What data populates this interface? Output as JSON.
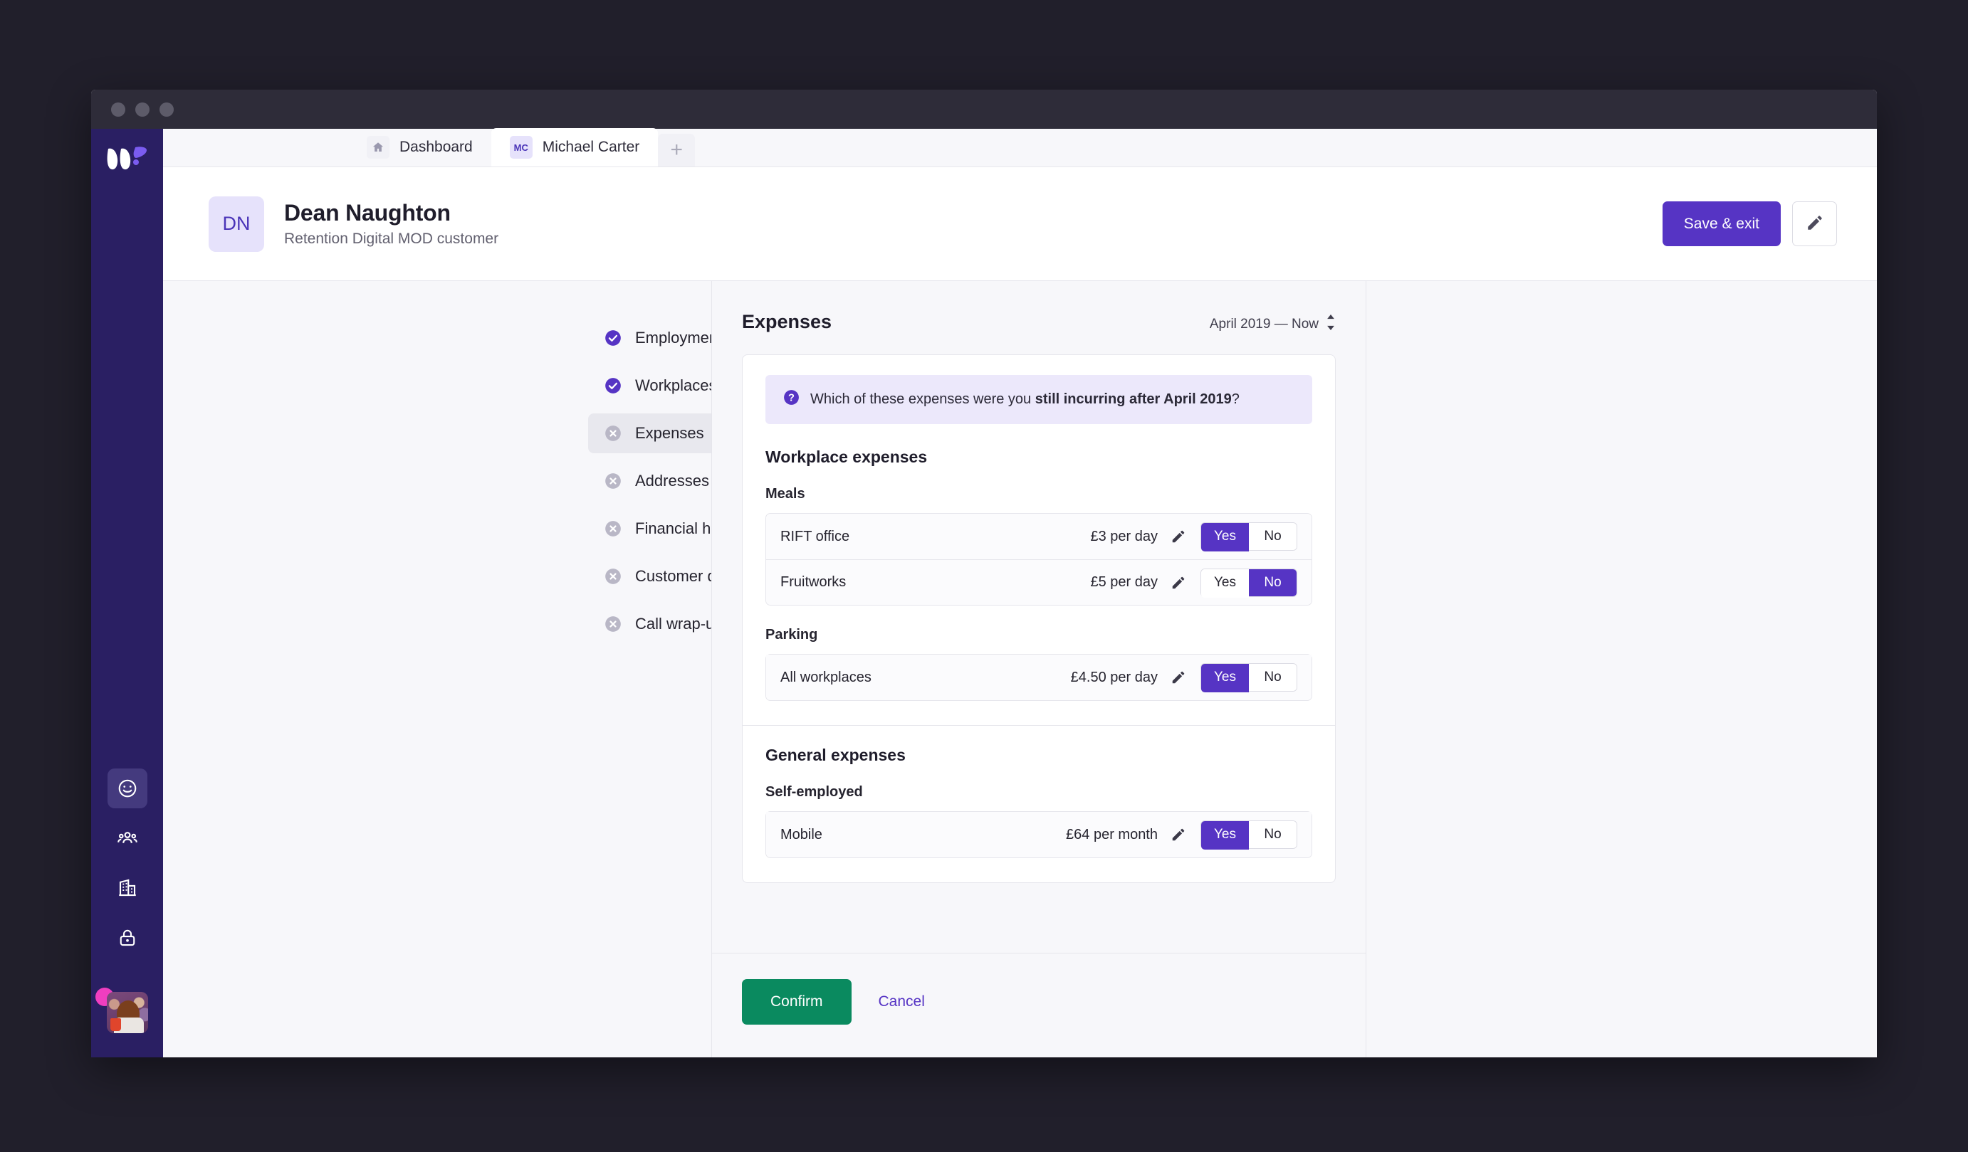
{
  "window": {
    "traffic_lights": [
      "close",
      "minimize",
      "zoom"
    ]
  },
  "rail": {
    "logo_name": "whatsapp-style-w-logo",
    "items": [
      {
        "name": "smiley-icon",
        "active": true
      },
      {
        "name": "people-icon",
        "active": false
      },
      {
        "name": "building-icon",
        "active": false
      },
      {
        "name": "lock-icon",
        "active": false
      }
    ],
    "avatar_alt": "user-photo",
    "has_notification": true
  },
  "tabs": [
    {
      "label": "Dashboard",
      "badge": "",
      "icon": "home-icon",
      "active": false
    },
    {
      "label": "Michael Carter",
      "badge": "MC",
      "icon": "",
      "active": true
    }
  ],
  "tab_add_label": "+",
  "header": {
    "initials": "DN",
    "name": "Dean Naughton",
    "subtitle": "Retention Digital MOD customer",
    "save_label": "Save & exit",
    "edit_icon": "pencil-icon"
  },
  "nav": {
    "items": [
      {
        "label": "Employments",
        "state": "complete",
        "selected": false
      },
      {
        "label": "Workplaces",
        "state": "complete",
        "selected": false
      },
      {
        "label": "Expenses",
        "state": "incomplete",
        "selected": true
      },
      {
        "label": "Addresses",
        "state": "incomplete",
        "selected": false
      },
      {
        "label": "Financial history",
        "state": "incomplete",
        "selected": false
      },
      {
        "label": "Customer details",
        "state": "incomplete",
        "selected": false
      },
      {
        "label": "Call wrap-up",
        "state": "incomplete",
        "selected": false
      }
    ]
  },
  "panel": {
    "title": "Expenses",
    "period": "April 2019 — Now",
    "banner": {
      "icon": "question-mark-icon",
      "text_before": "Which of these expenses were you ",
      "text_bold": "still incurring after April 2019",
      "text_after": "?"
    },
    "sections": [
      {
        "title": "Workplace expenses",
        "groups": [
          {
            "title": "Meals",
            "rows": [
              {
                "name": "RIFT office",
                "amount": "£3 per day",
                "yes_label": "Yes",
                "no_label": "No",
                "selected": "yes"
              },
              {
                "name": "Fruitworks",
                "amount": "£5 per day",
                "yes_label": "Yes",
                "no_label": "No",
                "selected": "no"
              }
            ]
          },
          {
            "title": "Parking",
            "rows": [
              {
                "name": "All workplaces",
                "amount": "£4.50 per day",
                "yes_label": "Yes",
                "no_label": "No",
                "selected": "yes"
              }
            ]
          }
        ]
      },
      {
        "title": "General expenses",
        "groups": [
          {
            "title": "Self-employed",
            "rows": [
              {
                "name": "Mobile",
                "amount": "£64 per month",
                "yes_label": "Yes",
                "no_label": "No",
                "selected": "yes"
              }
            ]
          }
        ]
      }
    ]
  },
  "footer": {
    "confirm_label": "Confirm",
    "cancel_label": "Cancel"
  },
  "colors": {
    "brand_purple": "#5634c4",
    "rail_navy": "#2a1f63",
    "confirm_green": "#0a8a5f",
    "banner_lavender": "#ece8fb",
    "page_bg": "#f7f7fa",
    "notification_pink": "#f03ec0"
  }
}
